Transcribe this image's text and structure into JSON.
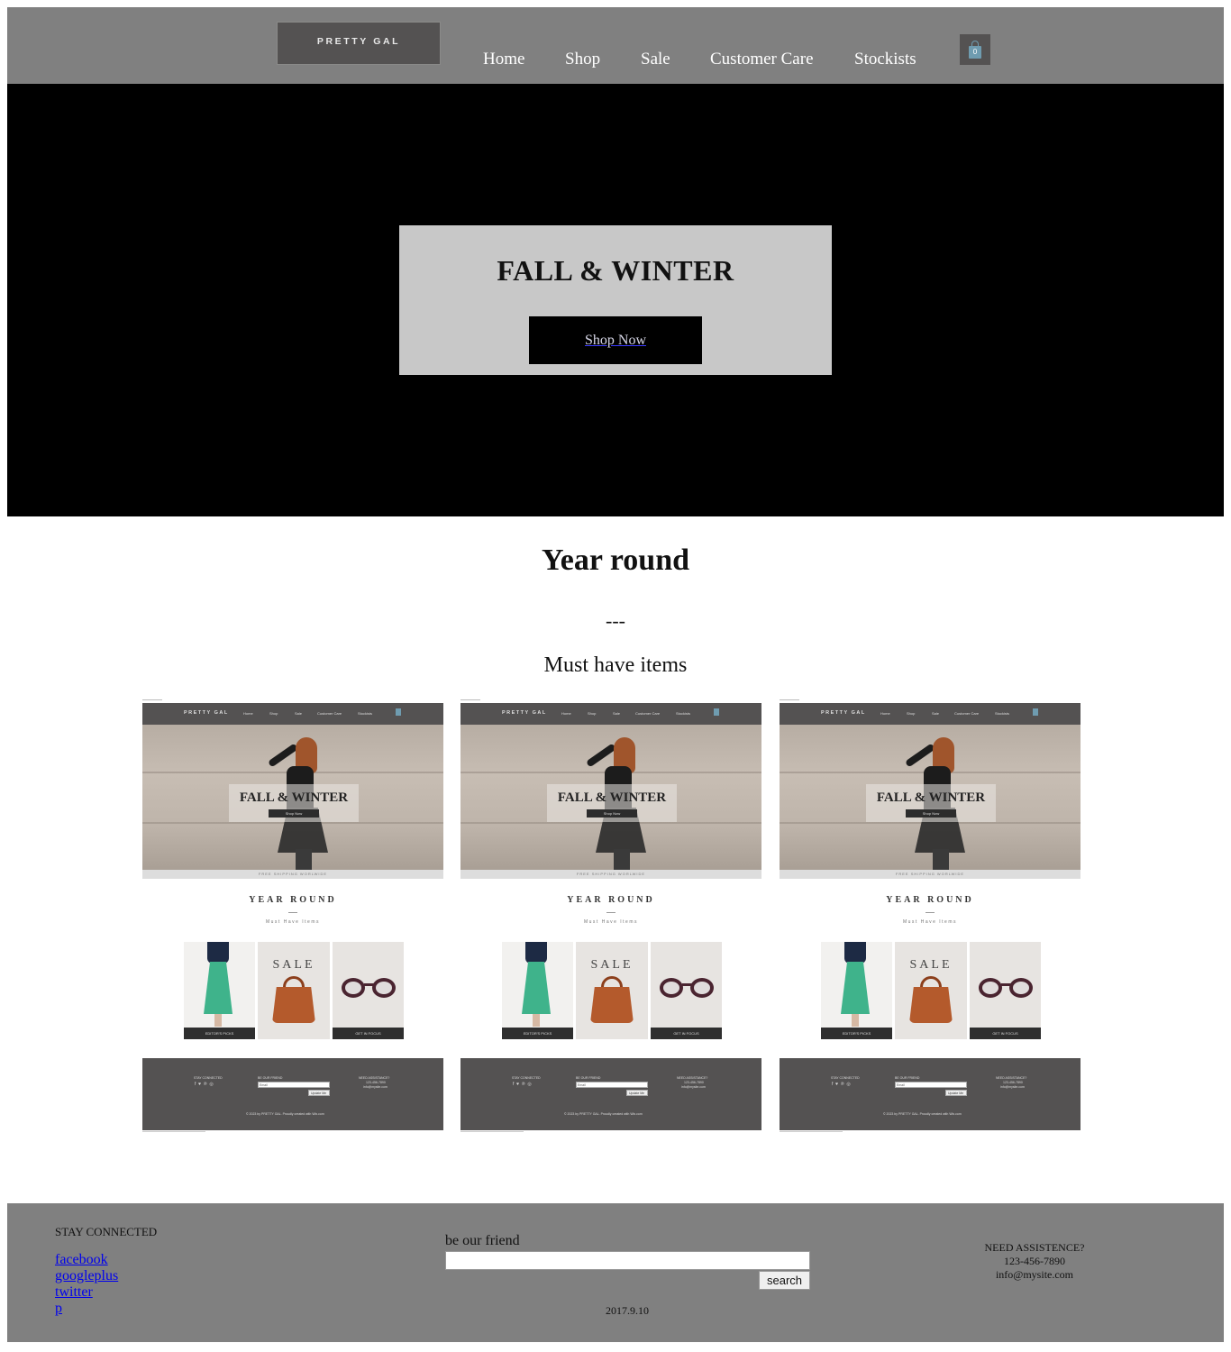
{
  "header": {
    "logo_text": "PRETTY GAL",
    "nav": [
      {
        "label": "Home"
      },
      {
        "label": "Shop"
      },
      {
        "label": "Sale"
      },
      {
        "label": "Customer Care"
      },
      {
        "label": "Stockists"
      }
    ],
    "cart_count": "0",
    "cart_icon": "shopping-bag-icon"
  },
  "hero": {
    "title": "FALL & WINTER",
    "button_label": "Shop Now"
  },
  "section": {
    "title": "Year round",
    "divider": "---",
    "subtitle": "Must have items"
  },
  "thumbnails": {
    "items": [
      {
        "logo": "PRETTY GAL",
        "nav": [
          "Home",
          "Shop",
          "Sale",
          "Customer Care",
          "Stockists"
        ],
        "hero_title": "FALL & WINTER",
        "hero_button": "Shop Now",
        "shipping": "FREE SHIPPING WORLWIDE",
        "section_title": "YEAR ROUND",
        "section_sub": "Must Have Items",
        "cards": [
          "EDITOR'S PICKS",
          "SALE",
          "GET IN FOCUS"
        ],
        "footer_cols": [
          "STAY CONNECTED",
          "BE OUR FRIEND",
          "NEED ASSISTANCE?"
        ],
        "footer_email_placeholder": "Email",
        "footer_button": "Update Me",
        "footer_phone": "123-456-7890",
        "footer_email": "info@mysite.com",
        "footer_copyright": "© 2023 by PRETTY GAL. Proudly created with Wix.com"
      },
      {
        "logo": "PRETTY GAL",
        "nav": [
          "Home",
          "Shop",
          "Sale",
          "Customer Care",
          "Stockists"
        ],
        "hero_title": "FALL & WINTER",
        "hero_button": "Shop Now",
        "shipping": "FREE SHIPPING WORLWIDE",
        "section_title": "YEAR ROUND",
        "section_sub": "Must Have Items",
        "cards": [
          "EDITOR'S PICKS",
          "SALE",
          "GET IN FOCUS"
        ],
        "footer_cols": [
          "STAY CONNECTED",
          "BE OUR FRIEND",
          "NEED ASSISTANCE?"
        ],
        "footer_email_placeholder": "Email",
        "footer_button": "Update Me",
        "footer_phone": "123-456-7890",
        "footer_email": "info@mysite.com",
        "footer_copyright": "© 2023 by PRETTY GAL. Proudly created with Wix.com"
      },
      {
        "logo": "PRETTY GAL",
        "nav": [
          "Home",
          "Shop",
          "Sale",
          "Customer Care",
          "Stockists"
        ],
        "hero_title": "FALL & WINTER",
        "hero_button": "Shop Now",
        "shipping": "FREE SHIPPING WORLWIDE",
        "section_title": "YEAR ROUND",
        "section_sub": "Must Have Items",
        "cards": [
          "EDITOR'S PICKS",
          "SALE",
          "GET IN FOCUS"
        ],
        "footer_cols": [
          "STAY CONNECTED",
          "BE OUR FRIEND",
          "NEED ASSISTANCE?"
        ],
        "footer_email_placeholder": "Email",
        "footer_button": "Update Me",
        "footer_phone": "123-456-7890",
        "footer_email": "info@mysite.com",
        "footer_copyright": "© 2023 by PRETTY GAL. Proudly created with Wix.com"
      }
    ]
  },
  "footer": {
    "stay_connected": "STAY CONNECTED",
    "social_links": [
      "facebook",
      "googleplus",
      "twitter",
      "p"
    ],
    "friend_label": "be our friend",
    "search_value": "",
    "search_button": "search",
    "date": "2017.9.10",
    "assist_title": "NEED ASSISTENCE?",
    "phone": "123-456-7890",
    "email": "info@mysite.com"
  },
  "colors": {
    "header_bg": "#808080",
    "hero_bg": "#000000",
    "hero_box_bg": "#c8c8c8",
    "logo_bg": "#545252",
    "footer_bg": "#808080",
    "link": "#0000ee"
  }
}
